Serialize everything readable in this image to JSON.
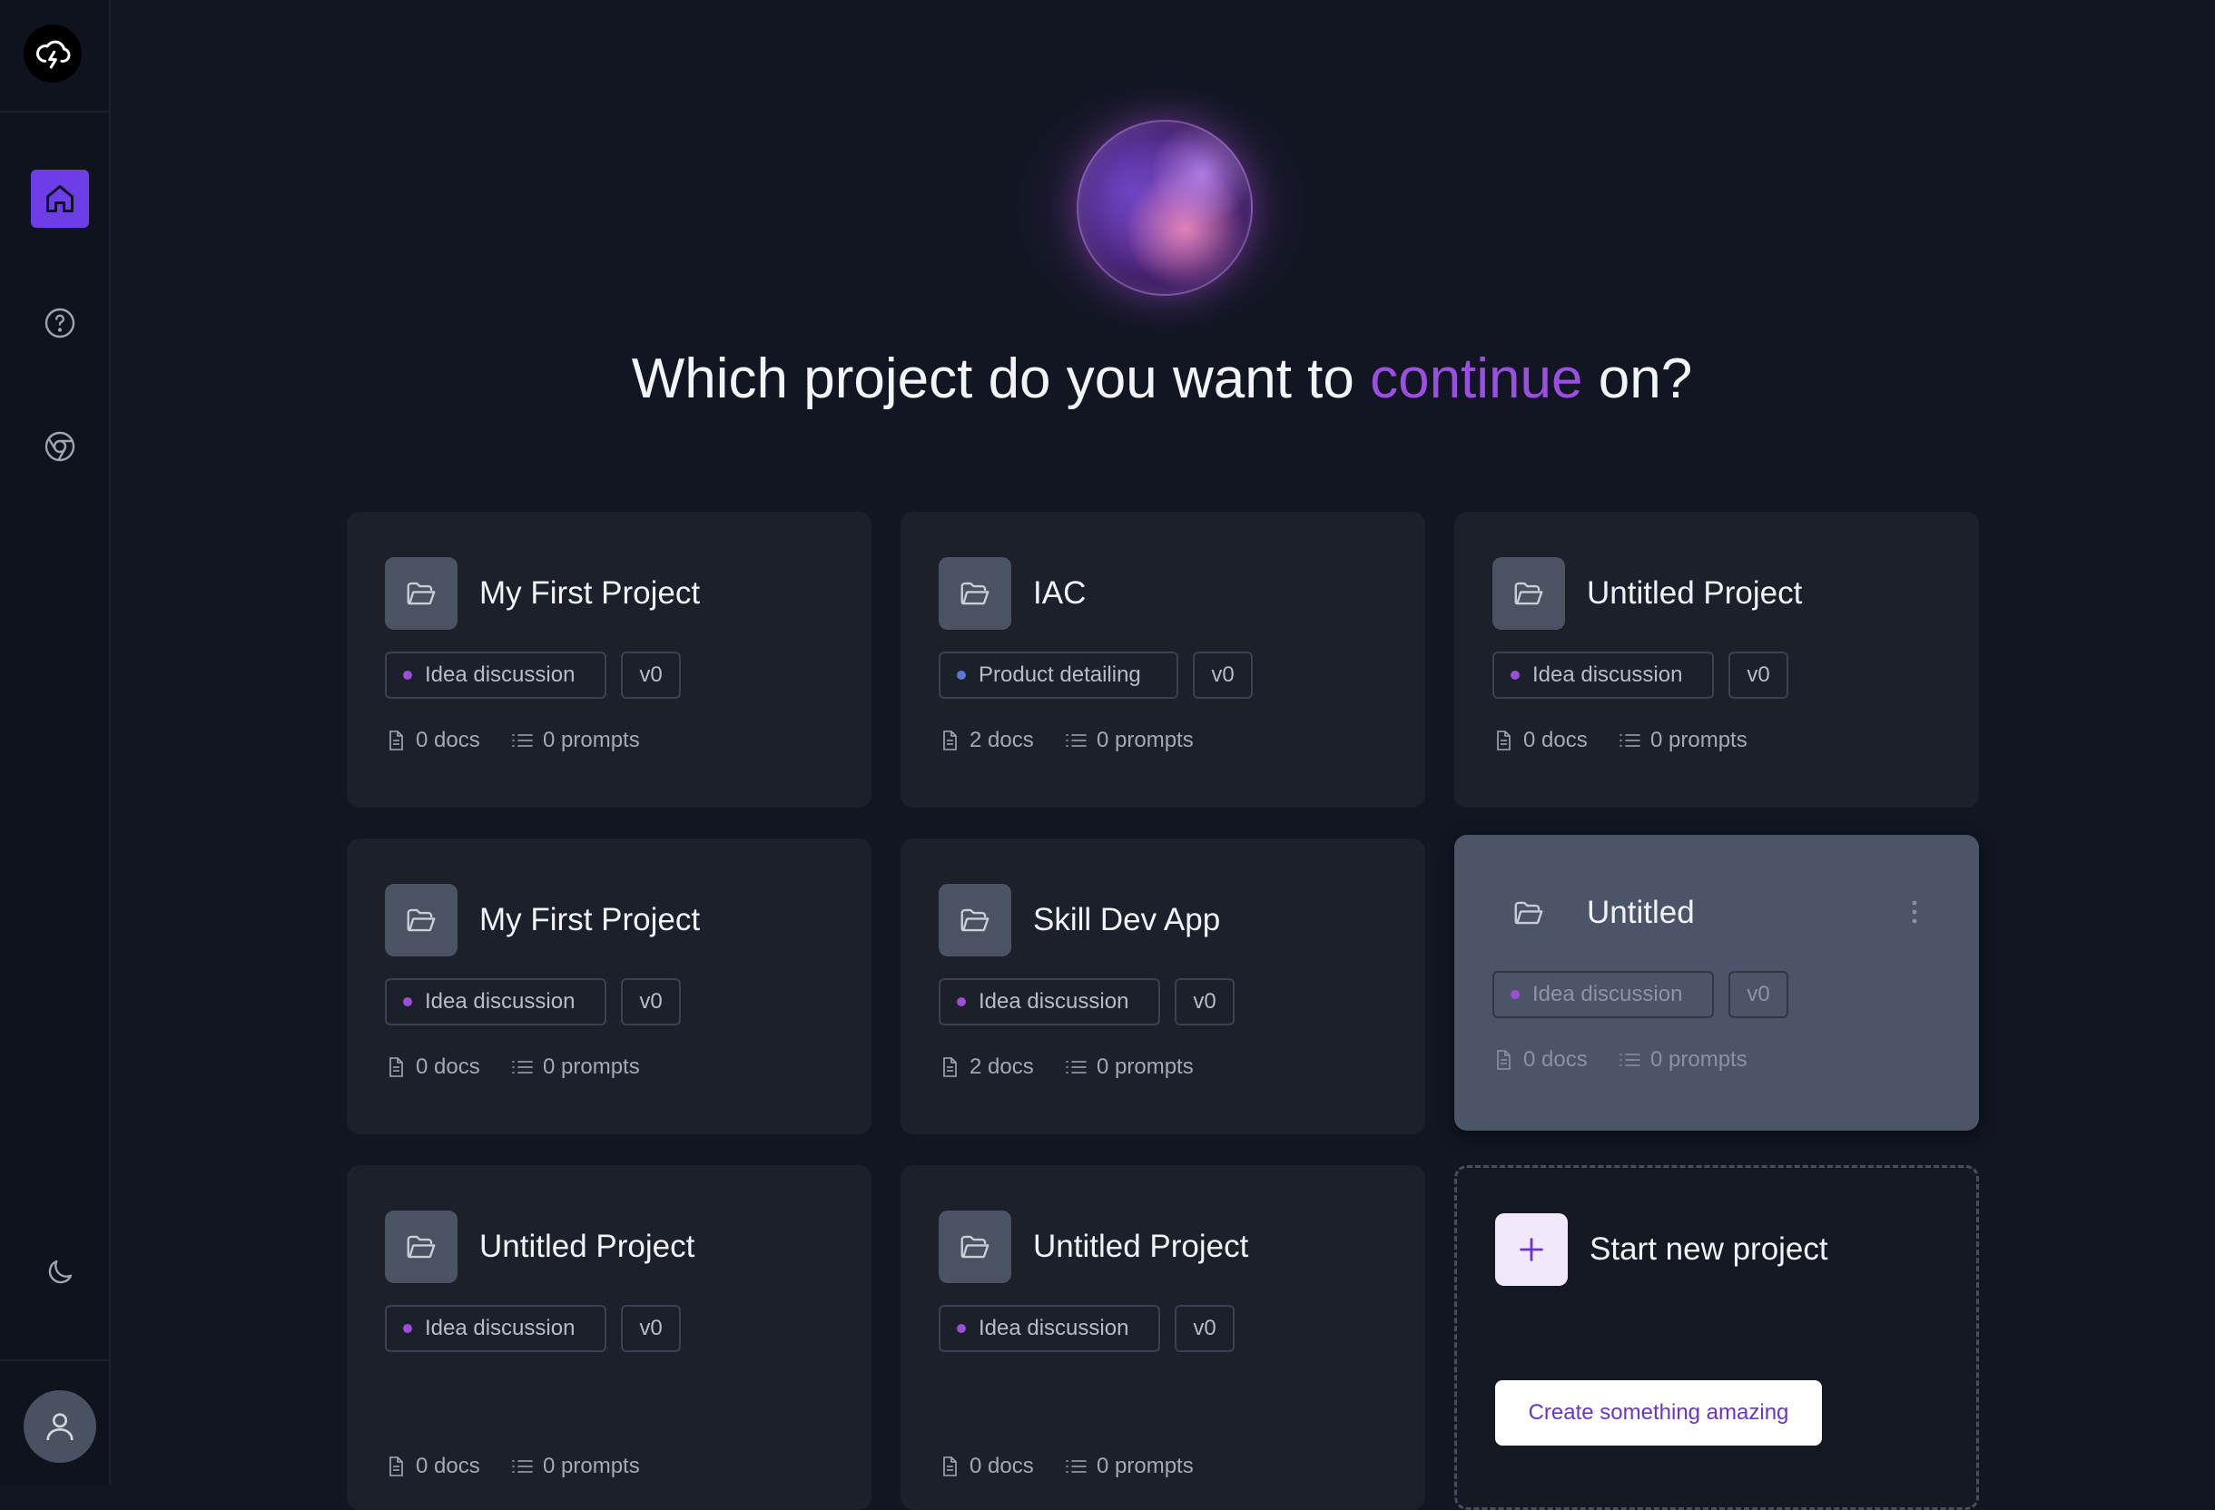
{
  "headline": {
    "prefix": "Which project do you want to",
    "accent": "continue",
    "suffix": "on?"
  },
  "colors": {
    "accent": "#9a4fe0",
    "active_nav": "#6d3ee8",
    "idea_dot": "#9b4fd8",
    "product_dot": "#5a78d6"
  },
  "sidebar": {
    "logo_icon": "cloud-lightning-icon",
    "items": [
      {
        "icon": "home-icon",
        "active": true
      },
      {
        "icon": "help-circle-icon",
        "active": false
      },
      {
        "icon": "chrome-icon",
        "active": false
      }
    ],
    "bottom": [
      {
        "icon": "moon-icon"
      },
      {
        "icon": "user-avatar-icon"
      }
    ]
  },
  "projects": [
    {
      "title": "My First Project",
      "stage": "Idea discussion",
      "version": "v0",
      "docs": "0 docs",
      "prompts": "0 prompts"
    },
    {
      "title": "IAC",
      "stage": "Product detailing",
      "version": "v0",
      "docs": "2 docs",
      "prompts": "0 prompts"
    },
    {
      "title": "Untitled Project",
      "stage": "Idea discussion",
      "version": "v0",
      "docs": "0 docs",
      "prompts": "0 prompts"
    },
    {
      "title": "My First Project",
      "stage": "Idea discussion",
      "version": "v0",
      "docs": "0 docs",
      "prompts": "0 prompts"
    },
    {
      "title": "Skill Dev App",
      "stage": "Idea discussion",
      "version": "v0",
      "docs": "2 docs",
      "prompts": "0 prompts"
    },
    {
      "title": "Untitled",
      "stage": "Idea discussion",
      "version": "v0",
      "docs": "0 docs",
      "prompts": "0 prompts"
    },
    {
      "title": "Untitled Project",
      "stage": "Idea discussion",
      "version": "v0",
      "docs": "0 docs",
      "prompts": "0 prompts"
    },
    {
      "title": "Untitled Project",
      "stage": "Idea discussion",
      "version": "v0",
      "docs": "0 docs",
      "prompts": "0 prompts"
    }
  ],
  "new_project": {
    "title": "Start new project",
    "button": "Create something amazing"
  }
}
